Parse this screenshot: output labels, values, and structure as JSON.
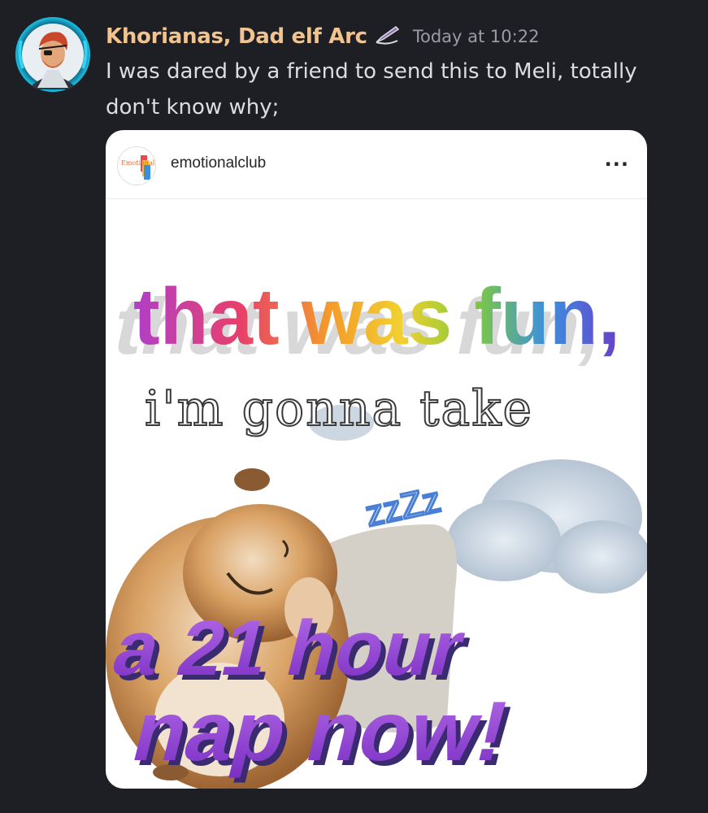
{
  "message": {
    "username": "Khorianas, Dad elf Arc",
    "badge_icon": "quill-icon",
    "timestamp": "Today at 10:22",
    "text": "I was dared by a friend to send this to Meli, totally don't know why;"
  },
  "attachment": {
    "post_account": "emotionalclub",
    "post_avatar_text": "Emotional Club",
    "more_icon": "more-dots-icon",
    "more_label": "...",
    "meme": {
      "line1_words": [
        "that",
        "was",
        "fun,"
      ],
      "line2": "i'm gonna take",
      "zzz": "zzZz",
      "line3": "a 21 hour",
      "line4": "nap now!"
    }
  },
  "colors": {
    "background": "#1e1f24",
    "username": "#f1c48f",
    "timestamp": "#9b9ca3",
    "message_text": "#dcdde1",
    "meme_purple": "#9b47d8"
  }
}
